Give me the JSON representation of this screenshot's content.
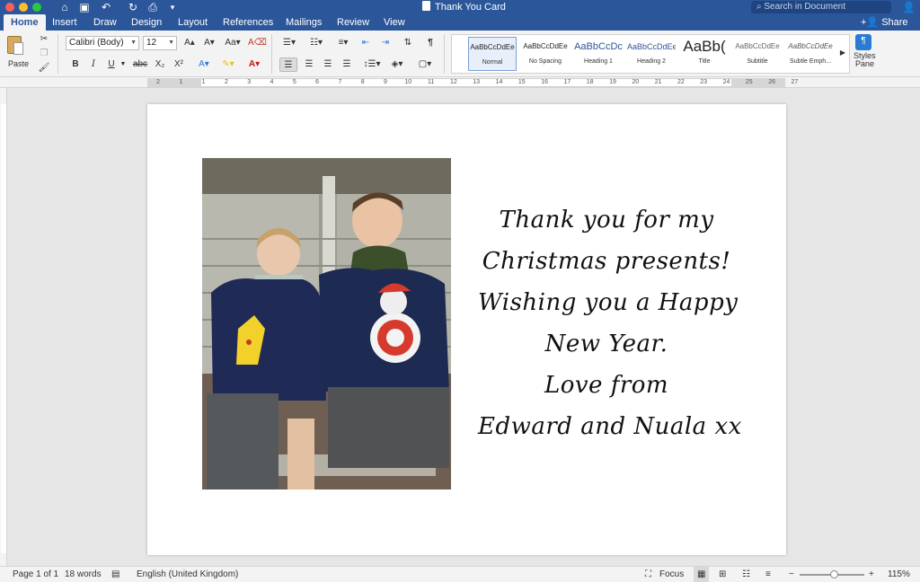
{
  "window": {
    "title": "Thank You Card"
  },
  "search": {
    "placeholder": "Search in Document"
  },
  "tabs": [
    "Home",
    "Insert",
    "Draw",
    "Design",
    "Layout",
    "References",
    "Mailings",
    "Review",
    "View"
  ],
  "share_label": "Share",
  "ribbon": {
    "paste_label": "Paste",
    "font_name": "Calibri (Body)",
    "font_size": "12",
    "bold": "B",
    "italic": "I",
    "underline": "U",
    "strike": "abc",
    "subscript": "X₂",
    "superscript": "X²",
    "styles": [
      {
        "preview": "AaBbCcDdEe",
        "name": "Normal"
      },
      {
        "preview": "AaBbCcDdEe",
        "name": "No Spacing"
      },
      {
        "preview": "AaBbCcDc",
        "name": "Heading 1"
      },
      {
        "preview": "AaBbCcDdEe",
        "name": "Heading 2"
      },
      {
        "preview": "AaBb(",
        "name": "Title"
      },
      {
        "preview": "AaBbCcDdEe",
        "name": "Subtitle"
      },
      {
        "preview": "AaBbCcDdEe",
        "name": "Subtle Emph..."
      }
    ],
    "styles_pane_line1": "Styles",
    "styles_pane_line2": "Pane"
  },
  "ruler": {
    "numbers": [
      "2",
      "1",
      "1",
      "2",
      "3",
      "4",
      "5",
      "6",
      "7",
      "8",
      "9",
      "10",
      "11",
      "12",
      "13",
      "14",
      "15",
      "16",
      "17",
      "18",
      "19",
      "20",
      "21",
      "22",
      "23",
      "24",
      "25",
      "26",
      "27"
    ]
  },
  "card": {
    "lines": [
      "Thank you for my",
      "Christmas presents!",
      "Wishing you a Happy",
      "New Year.",
      "Love from",
      "Edward and Nuala xx"
    ]
  },
  "status": {
    "page": "Page 1 of 1",
    "words": "18 words",
    "language": "English (United Kingdom)",
    "focus": "Focus",
    "zoom": "115%"
  },
  "colors": {
    "word_blue": "#2b579a",
    "ribbon_bg": "#f3f3f3",
    "canvas_bg": "#e6e6e6"
  }
}
